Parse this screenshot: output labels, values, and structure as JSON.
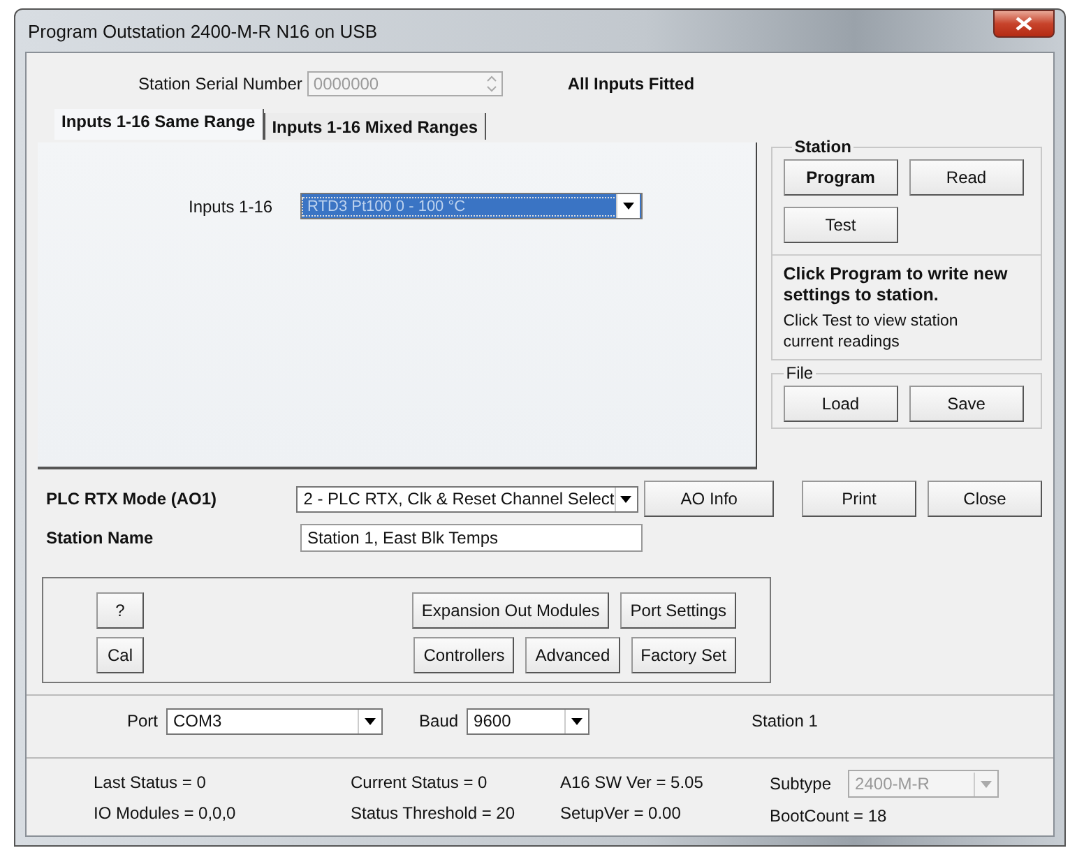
{
  "window": {
    "title": "Program Outstation 2400-M-R N16 on USB"
  },
  "serial": {
    "label": "Station Serial Number",
    "value": "0000000"
  },
  "inputs_status": "All Inputs Fitted",
  "tabs": [
    {
      "label": "Inputs 1-16 Same Range",
      "selected": true
    },
    {
      "label": "Inputs 1-16 Mixed Ranges",
      "selected": false
    }
  ],
  "inputs": {
    "label": "Inputs 1-16",
    "value": "RTD3 Pt100 0 - 100 °C"
  },
  "station_group": {
    "title": "Station",
    "buttons": [
      {
        "label": "Program",
        "bold": true
      },
      {
        "label": "Read",
        "bold": false
      },
      {
        "label": "Test",
        "bold": false
      }
    ],
    "note_bold": "Click Program to write new settings to station.",
    "note": "Click Test to view station current readings"
  },
  "file_group": {
    "title": "File",
    "buttons": [
      "Load",
      "Save"
    ]
  },
  "plc_mode": {
    "label": "PLC RTX Mode (AO1)",
    "value": "2 - PLC RTX, Clk & Reset Channel Select",
    "button": "AO Info"
  },
  "dialog_buttons": [
    "Print",
    "Close"
  ],
  "station_name": {
    "label": "Station Name",
    "value": "Station 1, East Blk Temps"
  },
  "tool_rows": [
    {
      "left": "?",
      "actions": [
        "Expansion Out Modules",
        "Port Settings"
      ]
    },
    {
      "left": "Cal",
      "actions": [
        "Controllers",
        "Advanced",
        "Factory Set"
      ]
    }
  ],
  "connection": {
    "port_label": "Port",
    "port": "COM3",
    "baud_label": "Baud",
    "baud": "9600",
    "station": "Station 1"
  },
  "status": [
    [
      "Last Status = 0",
      "IO Modules = 0,0,0"
    ],
    [
      "Current Status = 0",
      "Status Threshold = 20"
    ],
    [
      "A16 SW Ver = 5.05",
      "SetupVer = 0.00"
    ]
  ],
  "subtype": {
    "label": "Subtype",
    "value": "2400-M-R",
    "disabled": true
  },
  "boot_count": "BootCount = 18"
}
